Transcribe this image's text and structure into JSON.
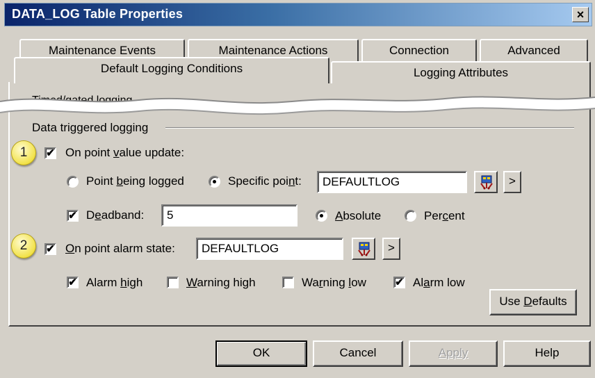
{
  "window": {
    "title": "DATA_LOG Table Properties",
    "close_glyph": "×"
  },
  "tabs": {
    "row_back": [
      "Maintenance Events",
      "Maintenance Actions",
      "Connection",
      "Advanced"
    ],
    "row_front": [
      "Default Logging Conditions",
      "Logging Attributes"
    ],
    "selected": "Default Logging Conditions"
  },
  "clipped_section_label": "Timed/gated logging",
  "data_triggered": {
    "title": "Data triggered logging",
    "on_point_value_update": {
      "label": "On point value update:",
      "checked": true,
      "callout": "1"
    },
    "point_being_logged": {
      "label": "Point being logged",
      "selected": false
    },
    "specific_point": {
      "label": "Specific point:",
      "selected": true,
      "value": "DEFAULTLOG"
    },
    "deadband": {
      "label": "Deadband:",
      "checked": true,
      "value": "5"
    },
    "absolute": {
      "label": "Absolute",
      "selected": true
    },
    "percent": {
      "label": "Percent",
      "selected": false
    },
    "on_point_alarm_state": {
      "label": "On point alarm state:",
      "checked": true,
      "value": "DEFAULTLOG",
      "callout": "2"
    },
    "alarm_high": {
      "label": "Alarm high",
      "checked": true
    },
    "warning_high": {
      "label": "Warning high",
      "checked": false
    },
    "warning_low": {
      "label": "Warning low",
      "checked": false
    },
    "alarm_low": {
      "label": "Alarm low",
      "checked": true
    },
    "use_defaults_label": "Use Defaults",
    "browse_arrow": ">"
  },
  "footer": {
    "ok": "OK",
    "cancel": "Cancel",
    "apply": "Apply",
    "help": "Help"
  },
  "colors": {
    "dialog_bg": "#d4d0c8",
    "title_gradient_start": "#0a246a",
    "callout_yellow": "#f2e24a"
  },
  "icons": [
    "close-icon",
    "point-browser-icon",
    "checkmark-icon",
    "radio-dot-icon"
  ]
}
